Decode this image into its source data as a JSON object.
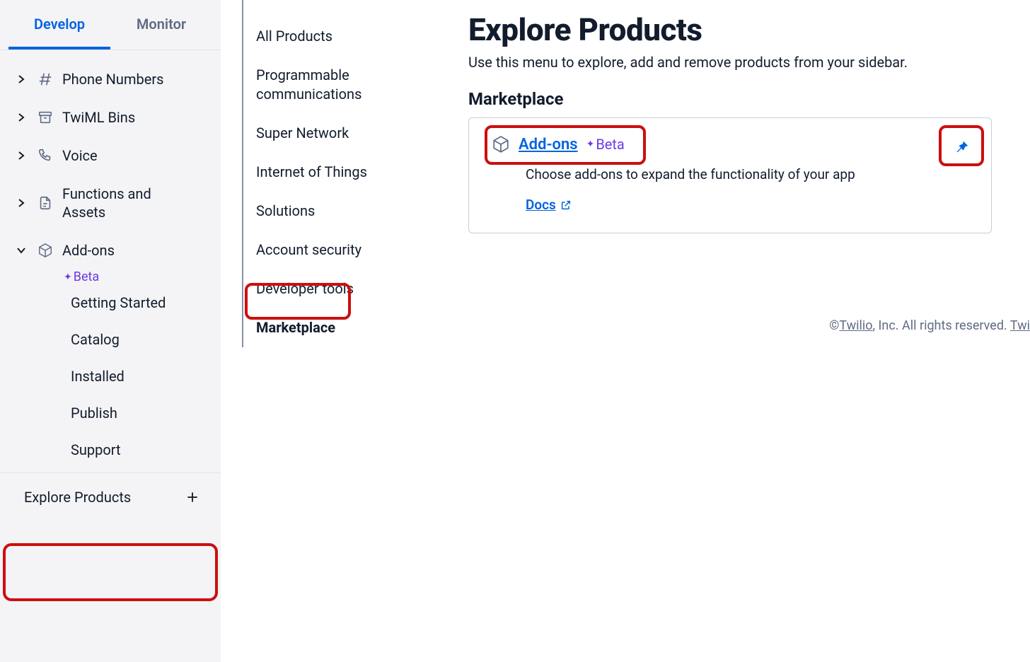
{
  "tabs": {
    "develop": "Develop",
    "monitor": "Monitor"
  },
  "sidebar": {
    "items": [
      {
        "label": "Phone Numbers"
      },
      {
        "label": "TwiML Bins"
      },
      {
        "label": "Voice"
      },
      {
        "label": "Functions and Assets"
      },
      {
        "label": "Add-ons"
      }
    ],
    "beta": "Beta",
    "addons_children": [
      {
        "label": "Getting Started"
      },
      {
        "label": "Catalog"
      },
      {
        "label": "Installed"
      },
      {
        "label": "Publish"
      },
      {
        "label": "Support"
      }
    ],
    "explore": "Explore Products"
  },
  "subnav": {
    "items": [
      {
        "label": "All Products"
      },
      {
        "label": "Programmable communications"
      },
      {
        "label": "Super Network"
      },
      {
        "label": "Internet of Things"
      },
      {
        "label": "Solutions"
      },
      {
        "label": "Account security"
      },
      {
        "label": "Developer tools"
      },
      {
        "label": "Marketplace"
      }
    ]
  },
  "main": {
    "title": "Explore Products",
    "subtitle": "Use this menu to explore, add and remove products from your sidebar.",
    "section": "Marketplace",
    "card": {
      "title": "Add-ons",
      "beta": "Beta",
      "description": "Choose add-ons to expand the functionality of your app",
      "docs": "Docs"
    }
  },
  "footer": {
    "copyright": "©",
    "twilio": "Twilio",
    "rest": ", Inc. All rights reserved. ",
    "twi": "Twi"
  }
}
